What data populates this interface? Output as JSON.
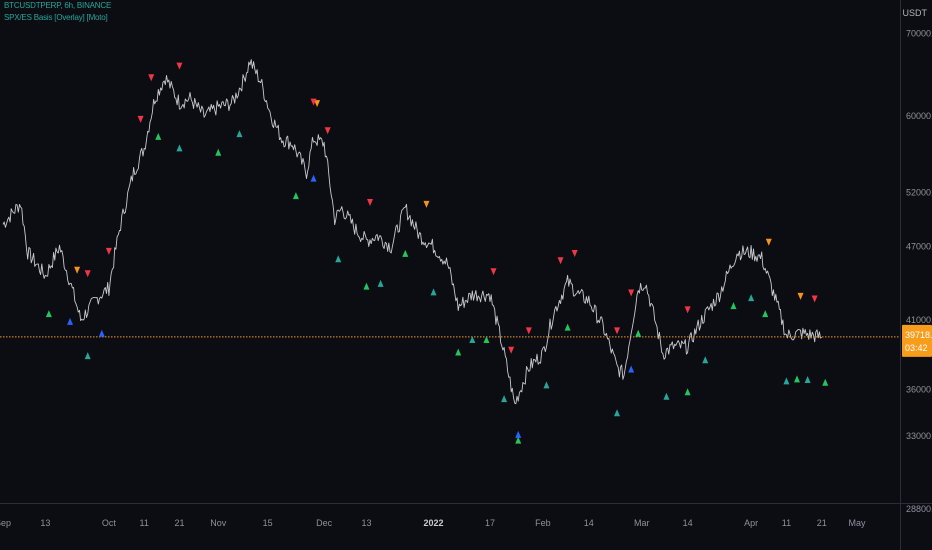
{
  "header": {
    "symbol_line": "BTCUSDTPERP, 6h, BINANCE",
    "indicator_line": "SPX/ES Basis [Overlay] [Moto]",
    "currency": "USDT"
  },
  "colors": {
    "background": "#0c0d12",
    "price_line": "#c8c9d0",
    "price_axis_text": "#8f929b",
    "orange_marker": "#f7931a",
    "red_marker": "#f23645",
    "green_marker": "#22c55e",
    "teal_marker": "#26a69a",
    "blue_marker": "#2962ff",
    "current_price_line": "#f89c1c"
  },
  "price_axis": {
    "labels": [
      "70000.0",
      "60000.0",
      "52000.0",
      "47000.0",
      "41000.0",
      "36000.0",
      "33000.0",
      "28800.0"
    ],
    "current_price": "39718.3",
    "countdown": "03:42"
  },
  "time_axis": {
    "labels": [
      "Sep",
      "13",
      "Oct",
      "11",
      "21",
      "Nov",
      "15",
      "Dec",
      "13",
      "2022",
      "17",
      "Feb",
      "14",
      "Mar",
      "14",
      "Apr",
      "11",
      "21",
      "May"
    ],
    "highlighted": "2022"
  },
  "chart_data": {
    "type": "line",
    "title": "BTCUSDTPERP, 6h, BINANCE",
    "series": [
      {
        "name": "BTCUSDTPERP",
        "x": [
          "Sep 1",
          "Sep 6",
          "Sep 8",
          "Sep 13",
          "Sep 17",
          "Sep 21",
          "Sep 23",
          "Sep 28",
          "Oct 1",
          "Oct 4",
          "Oct 8",
          "Oct 11",
          "Oct 14",
          "Oct 17",
          "Oct 21",
          "Oct 24",
          "Oct 28",
          "Nov 1",
          "Nov 5",
          "Nov 8",
          "Nov 10",
          "Nov 13",
          "Nov 16",
          "Nov 19",
          "Nov 22",
          "Nov 26",
          "Nov 28",
          "Dec 1",
          "Dec 4",
          "Dec 6",
          "Dec 10",
          "Dec 13",
          "Dec 16",
          "Dec 20",
          "Dec 24",
          "Dec 28",
          "Jan 1",
          "Jan 5",
          "Jan 8",
          "Jan 12",
          "Jan 17",
          "Jan 21",
          "Jan 24",
          "Jan 28",
          "Feb 1",
          "Feb 4",
          "Feb 8",
          "Feb 11",
          "Feb 14",
          "Feb 18",
          "Feb 22",
          "Feb 24",
          "Feb 28",
          "Mar 2",
          "Mar 7",
          "Mar 10",
          "Mar 14",
          "Mar 18",
          "Mar 23",
          "Mar 28",
          "Apr 1",
          "Apr 4",
          "Apr 8",
          "Apr 11",
          "Apr 15",
          "Apr 19",
          "Apr 21"
        ],
        "values": [
          49000,
          51000,
          46500,
          44500,
          47000,
          43000,
          41000,
          42800,
          43500,
          48500,
          54000,
          56500,
          62000,
          64500,
          61500,
          62000,
          60000,
          61000,
          61500,
          64000,
          66500,
          64000,
          60000,
          57500,
          57000,
          54000,
          57500,
          57000,
          49500,
          50500,
          48500,
          47500,
          48000,
          47000,
          50500,
          48000,
          47000,
          45500,
          42000,
          43000,
          43000,
          38500,
          35000,
          37500,
          38500,
          41500,
          44000,
          43000,
          42500,
          40500,
          37500,
          37000,
          43500,
          44000,
          38500,
          39000,
          39000,
          41000,
          43000,
          46500,
          46500,
          46000,
          42500,
          39800,
          40000,
          39800,
          39700
        ]
      }
    ],
    "markers": {
      "orange_down": [
        "Sep 22",
        "Nov 29",
        "Dec 30",
        "Apr 6",
        "Apr 15"
      ],
      "red_down": [
        "Sep 25",
        "Oct 1",
        "Oct 10",
        "Oct 13",
        "Oct 21",
        "Nov 28",
        "Dec 2",
        "Dec 14",
        "Jan 18",
        "Jan 23",
        "Jan 28",
        "Feb 6",
        "Feb 10",
        "Feb 22",
        "Feb 26",
        "Mar 14",
        "Apr 19"
      ],
      "green_up": [
        "Sep 14",
        "Sep 25",
        "Oct 15",
        "Oct 21",
        "Nov 1",
        "Nov 7",
        "Nov 23",
        "Dec 5",
        "Dec 13",
        "Dec 17",
        "Dec 24",
        "Jan 1",
        "Jan 8",
        "Jan 12",
        "Jan 16",
        "Jan 21",
        "Jan 25",
        "Feb 2",
        "Feb 8",
        "Feb 22",
        "Feb 28",
        "Mar 8",
        "Mar 14",
        "Mar 19",
        "Mar 27",
        "Apr 1",
        "Apr 5",
        "Apr 11",
        "Apr 14",
        "Apr 17",
        "Apr 22"
      ],
      "blue_up": [
        "Sep 20",
        "Sep 29",
        "Nov 28",
        "Jan 25",
        "Feb 26"
      ]
    },
    "xlabel": "",
    "ylabel": "",
    "ylim": [
      26800,
      73000
    ],
    "grid": false,
    "current_price_line": 39718.3,
    "legend_position": "top-left"
  }
}
